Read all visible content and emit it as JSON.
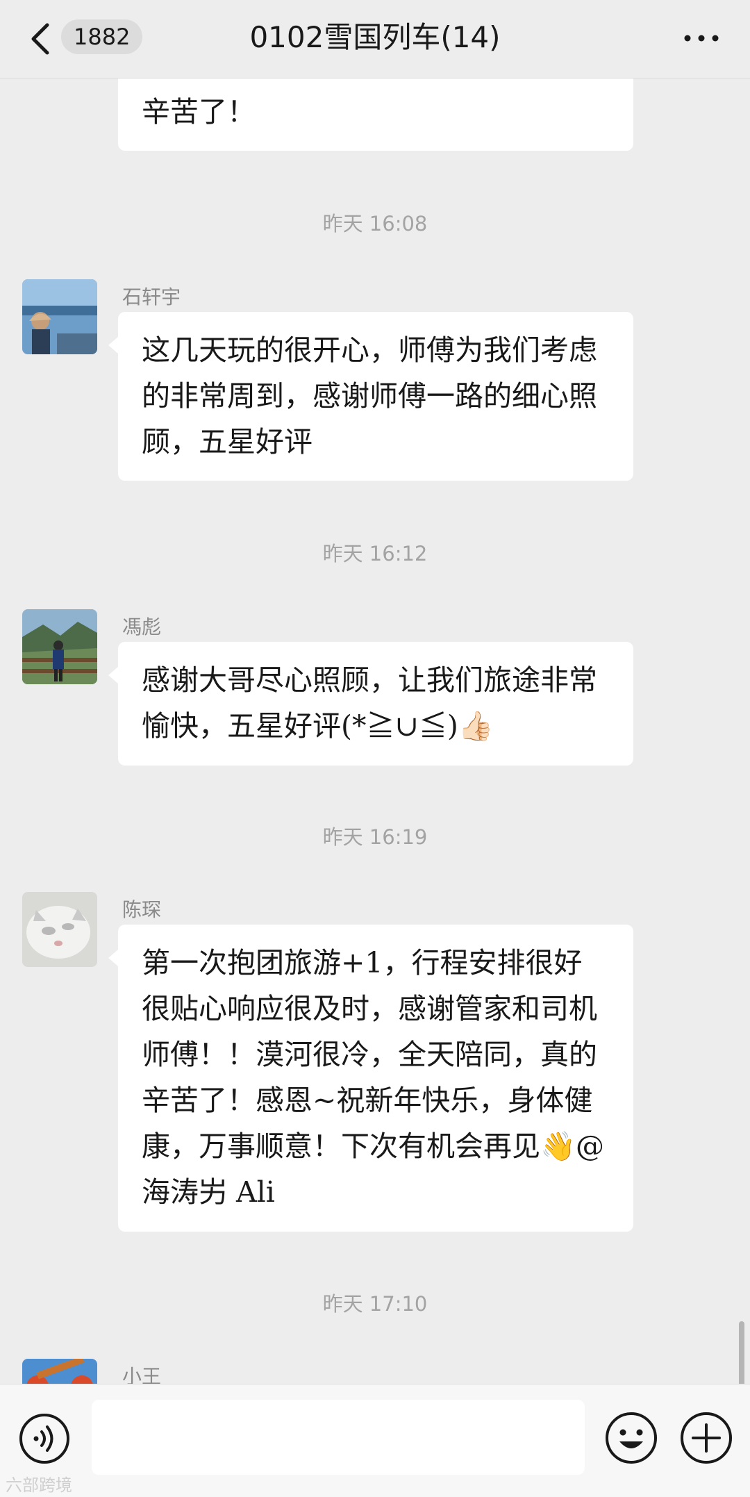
{
  "header": {
    "unread_count": "1882",
    "title": "0102雪国列车(14)"
  },
  "messages": [
    {
      "text": "辛苦了！"
    },
    {
      "time": "昨天 16:08",
      "sender": "石轩宇",
      "text": "这几天玩的很开心，师傅为我们考虑的非常周到，感谢师傅一路的细心照顾，五星好评"
    },
    {
      "time": "昨天 16:12",
      "sender": "馮彪",
      "text": "感谢大哥尽心照顾，让我们旅途非常愉快，五星好评(*≧∪≦)👍🏻"
    },
    {
      "time": "昨天 16:19",
      "sender": "陈琛",
      "text": "第一次抱团旅游+1，行程安排很好很贴心响应很及时，感谢管家和司机师傅！！漠河很冷，全天陪同，真的辛苦了！感恩~祝新年快乐，身体健康，万事顺意！下次有机会再见👋@海涛屴 Ali"
    },
    {
      "time": "昨天 17:10",
      "sender": "小王"
    }
  ],
  "input": {
    "value": ""
  },
  "watermark": "六部跨境",
  "colors": {
    "background": "#ededed",
    "bubble": "#ffffff",
    "timestamp": "#a3a3a3"
  }
}
